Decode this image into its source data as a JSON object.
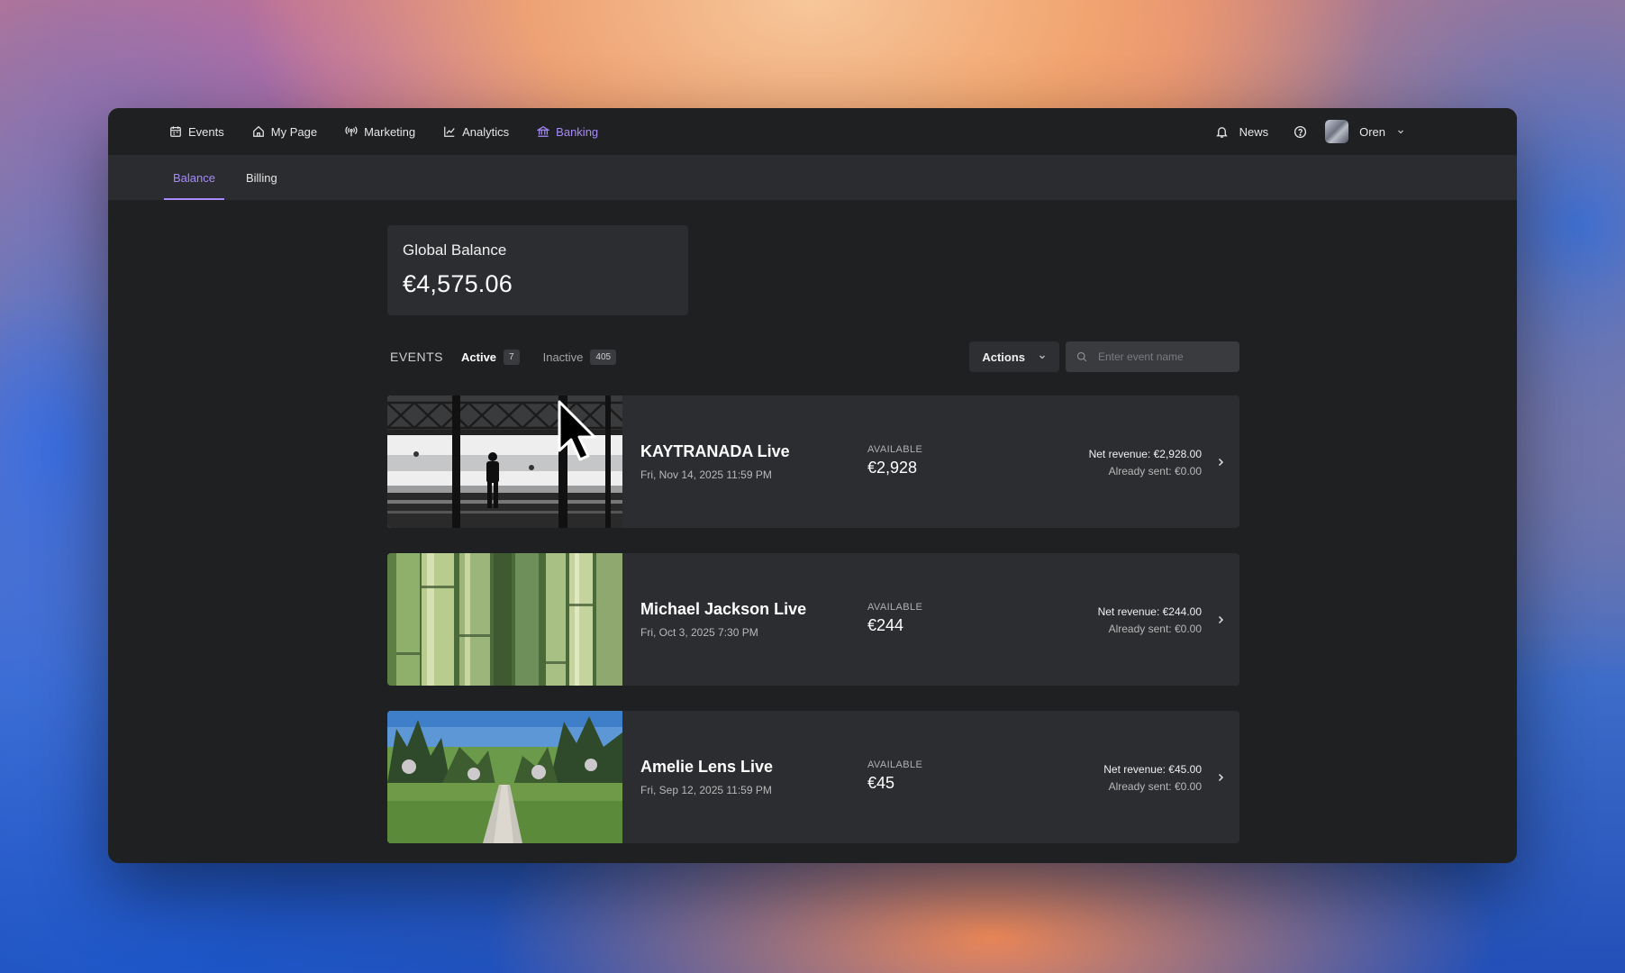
{
  "nav": {
    "items": [
      {
        "label": "Events",
        "icon": "calendar-icon"
      },
      {
        "label": "My Page",
        "icon": "home-icon"
      },
      {
        "label": "Marketing",
        "icon": "broadcast-icon"
      },
      {
        "label": "Analytics",
        "icon": "chart-icon"
      },
      {
        "label": "Banking",
        "icon": "bank-icon"
      }
    ],
    "active": "Banking",
    "news_label": "News",
    "user_name": "Oren"
  },
  "subnav": {
    "tabs": [
      {
        "label": "Balance"
      },
      {
        "label": "Billing"
      }
    ],
    "active": "Balance"
  },
  "balance": {
    "title": "Global Balance",
    "value": "€4,575.06"
  },
  "events_bar": {
    "label": "EVENTS",
    "filters": [
      {
        "label": "Active",
        "count": "7"
      },
      {
        "label": "Inactive",
        "count": "405"
      }
    ],
    "actions_label": "Actions",
    "search_placeholder": "Enter event name"
  },
  "events": [
    {
      "name": "KAYTRANADA Live",
      "date": "Fri, Nov 14, 2025 11:59 PM",
      "available_label": "AVAILABLE",
      "available": "€2,928",
      "net_revenue": "Net revenue: €2,928.00",
      "already_sent": "Already sent: €0.00"
    },
    {
      "name": "Michael Jackson Live",
      "date": "Fri, Oct 3, 2025 7:30 PM",
      "available_label": "AVAILABLE",
      "available": "€244",
      "net_revenue": "Net revenue: €244.00",
      "already_sent": "Already sent: €0.00"
    },
    {
      "name": "Amelie Lens Live",
      "date": "Fri, Sep 12, 2025 11:59 PM",
      "available_label": "AVAILABLE",
      "available": "€45",
      "net_revenue": "Net revenue: €45.00",
      "already_sent": "Already sent: €0.00"
    }
  ],
  "colors": {
    "accent": "#a78bfa",
    "window_bg": "#1f2022",
    "card_bg": "#2c2d30"
  }
}
